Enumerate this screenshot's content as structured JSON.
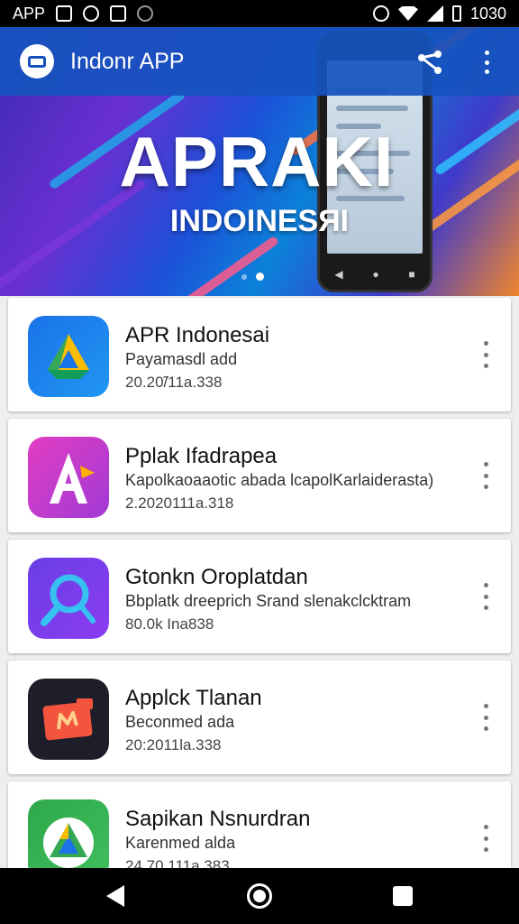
{
  "status_bar": {
    "app_label": "APP",
    "time": "1030"
  },
  "hero": {
    "toolbar_title": "Indonr APP",
    "headline": "APRAKI",
    "subheadline": "INDOINESЯI",
    "carousel_pages": 2,
    "carousel_active": 2
  },
  "apps": [
    {
      "title": "APR Indonesai",
      "subtitle": "Payamasdl add",
      "meta": "20.20̃/11a.338",
      "icon": "drive-triangle-icon",
      "icon_bg": [
        "#1a73e8",
        "#2196f3"
      ]
    },
    {
      "title": "Pplak Ifadrapea",
      "subtitle": "Kapolkaoaaotic abada lcapolKarlaiderasta)",
      "meta": "2.2020111a.318",
      "icon": "letter-a-icon",
      "icon_bg": [
        "#e23dc2",
        "#a13ad6"
      ]
    },
    {
      "title": "Gtonkn Oroplatdan",
      "subtitle": "Bbplatk dreeprich Srand slenakclcktram",
      "meta": "80.0k Ina838",
      "icon": "magnifier-icon",
      "icon_bg": [
        "#6a3ee6",
        "#8b3cf0"
      ]
    },
    {
      "title": "Applck Tlanan",
      "subtitle": "Beconmed ada",
      "meta": "20:2011la.338",
      "icon": "wallet-icon",
      "icon_bg": [
        "#1e1e2a",
        "#2c2c3a"
      ]
    },
    {
      "title": "Sapikan Nsnurdran",
      "subtitle": "Karenmed alda",
      "meta": "24.70.111a.383",
      "icon": "nature-triangle-icon",
      "icon_bg": [
        "#2ea84a",
        "#3fbf5d"
      ]
    }
  ],
  "colors": {
    "toolbar": "#1652be",
    "status_bar": "#000000",
    "nav_bar": "#000000"
  }
}
